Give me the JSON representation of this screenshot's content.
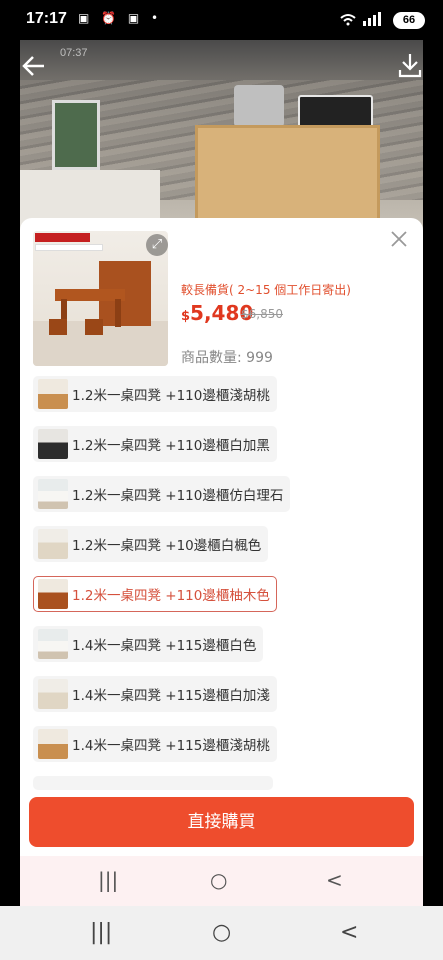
{
  "status": {
    "time": "17:17",
    "battery": "66"
  },
  "background_photo": {
    "inner_time": "07:37"
  },
  "product": {
    "stock_note": "較長備貨( 2~15 個工作日寄出)",
    "price_currency": "$",
    "price_amount": "5,480",
    "old_price": "$6,850",
    "quantity_label": "商品數量: 999"
  },
  "variants": [
    {
      "label": "1.2米一桌四凳 +110邊櫃淺胡桃",
      "selected": false
    },
    {
      "label": "1.2米一桌四凳 +110邊櫃白加黑",
      "selected": false
    },
    {
      "label": "1.2米一桌四凳 +110邊櫃仿白理石",
      "selected": false
    },
    {
      "label": "1.2米一桌四凳 +10邊櫃白楓色",
      "selected": false
    },
    {
      "label": "1.2米一桌四凳 +110邊櫃柚木色",
      "selected": true
    },
    {
      "label": "1.4米一桌四凳 +115邊櫃白色",
      "selected": false
    },
    {
      "label": "1.4米一桌四凳 +115邊櫃白加淺",
      "selected": false
    },
    {
      "label": "1.4米一桌四凳 +115邊櫃淺胡桃",
      "selected": false
    }
  ],
  "buy_button": "直接購買",
  "nav": {
    "recent": "|||",
    "home": "○",
    "back": "<"
  },
  "colors": {
    "accent": "#ee4d2d",
    "price": "#e0381f",
    "selected_border": "#d5665a"
  }
}
